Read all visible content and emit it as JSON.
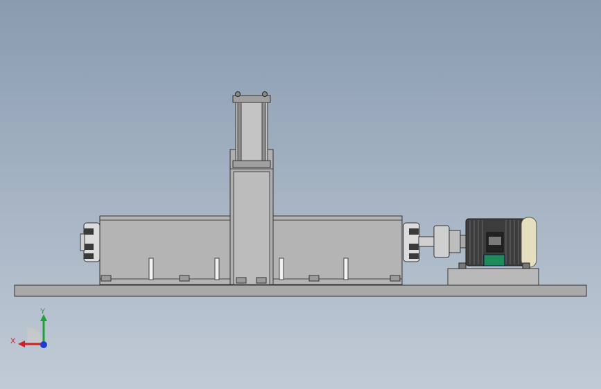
{
  "viewport": {
    "background_top": "#8a9bb0",
    "background_bottom": "#c1cbd6"
  },
  "model": {
    "frame_color": "#a8a8a8",
    "housing_color": "#b4b4b4",
    "motor_body_color": "#3c3c3c",
    "motor_endcap_color": "#e6dfbf",
    "motor_mount_color": "#1f8a5a"
  },
  "triad": {
    "x_label": "X",
    "y_label": "Y",
    "x_color": "#d21e1e",
    "y_color": "#1ea03c",
    "z_color": "#1e3cd2"
  }
}
